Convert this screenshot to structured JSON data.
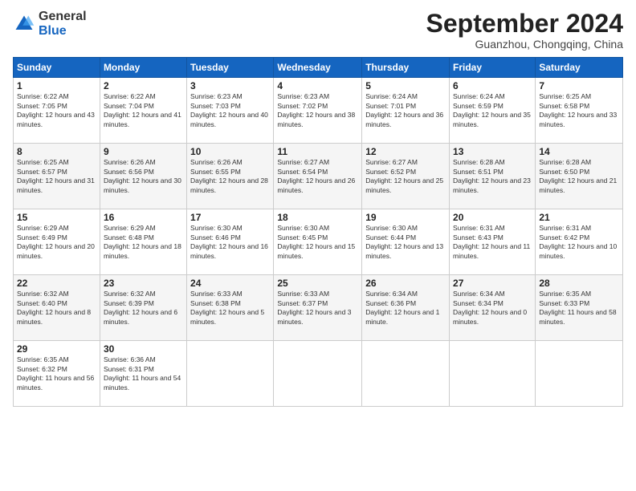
{
  "header": {
    "logo_general": "General",
    "logo_blue": "Blue",
    "month_title": "September 2024",
    "subtitle": "Guanzhou, Chongqing, China"
  },
  "weekdays": [
    "Sunday",
    "Monday",
    "Tuesday",
    "Wednesday",
    "Thursday",
    "Friday",
    "Saturday"
  ],
  "weeks": [
    [
      {
        "day": "1",
        "sunrise": "6:22 AM",
        "sunset": "7:05 PM",
        "daylight": "12 hours and 43 minutes."
      },
      {
        "day": "2",
        "sunrise": "6:22 AM",
        "sunset": "7:04 PM",
        "daylight": "12 hours and 41 minutes."
      },
      {
        "day": "3",
        "sunrise": "6:23 AM",
        "sunset": "7:03 PM",
        "daylight": "12 hours and 40 minutes."
      },
      {
        "day": "4",
        "sunrise": "6:23 AM",
        "sunset": "7:02 PM",
        "daylight": "12 hours and 38 minutes."
      },
      {
        "day": "5",
        "sunrise": "6:24 AM",
        "sunset": "7:01 PM",
        "daylight": "12 hours and 36 minutes."
      },
      {
        "day": "6",
        "sunrise": "6:24 AM",
        "sunset": "6:59 PM",
        "daylight": "12 hours and 35 minutes."
      },
      {
        "day": "7",
        "sunrise": "6:25 AM",
        "sunset": "6:58 PM",
        "daylight": "12 hours and 33 minutes."
      }
    ],
    [
      {
        "day": "8",
        "sunrise": "6:25 AM",
        "sunset": "6:57 PM",
        "daylight": "12 hours and 31 minutes."
      },
      {
        "day": "9",
        "sunrise": "6:26 AM",
        "sunset": "6:56 PM",
        "daylight": "12 hours and 30 minutes."
      },
      {
        "day": "10",
        "sunrise": "6:26 AM",
        "sunset": "6:55 PM",
        "daylight": "12 hours and 28 minutes."
      },
      {
        "day": "11",
        "sunrise": "6:27 AM",
        "sunset": "6:54 PM",
        "daylight": "12 hours and 26 minutes."
      },
      {
        "day": "12",
        "sunrise": "6:27 AM",
        "sunset": "6:52 PM",
        "daylight": "12 hours and 25 minutes."
      },
      {
        "day": "13",
        "sunrise": "6:28 AM",
        "sunset": "6:51 PM",
        "daylight": "12 hours and 23 minutes."
      },
      {
        "day": "14",
        "sunrise": "6:28 AM",
        "sunset": "6:50 PM",
        "daylight": "12 hours and 21 minutes."
      }
    ],
    [
      {
        "day": "15",
        "sunrise": "6:29 AM",
        "sunset": "6:49 PM",
        "daylight": "12 hours and 20 minutes."
      },
      {
        "day": "16",
        "sunrise": "6:29 AM",
        "sunset": "6:48 PM",
        "daylight": "12 hours and 18 minutes."
      },
      {
        "day": "17",
        "sunrise": "6:30 AM",
        "sunset": "6:46 PM",
        "daylight": "12 hours and 16 minutes."
      },
      {
        "day": "18",
        "sunrise": "6:30 AM",
        "sunset": "6:45 PM",
        "daylight": "12 hours and 15 minutes."
      },
      {
        "day": "19",
        "sunrise": "6:30 AM",
        "sunset": "6:44 PM",
        "daylight": "12 hours and 13 minutes."
      },
      {
        "day": "20",
        "sunrise": "6:31 AM",
        "sunset": "6:43 PM",
        "daylight": "12 hours and 11 minutes."
      },
      {
        "day": "21",
        "sunrise": "6:31 AM",
        "sunset": "6:42 PM",
        "daylight": "12 hours and 10 minutes."
      }
    ],
    [
      {
        "day": "22",
        "sunrise": "6:32 AM",
        "sunset": "6:40 PM",
        "daylight": "12 hours and 8 minutes."
      },
      {
        "day": "23",
        "sunrise": "6:32 AM",
        "sunset": "6:39 PM",
        "daylight": "12 hours and 6 minutes."
      },
      {
        "day": "24",
        "sunrise": "6:33 AM",
        "sunset": "6:38 PM",
        "daylight": "12 hours and 5 minutes."
      },
      {
        "day": "25",
        "sunrise": "6:33 AM",
        "sunset": "6:37 PM",
        "daylight": "12 hours and 3 minutes."
      },
      {
        "day": "26",
        "sunrise": "6:34 AM",
        "sunset": "6:36 PM",
        "daylight": "12 hours and 1 minute."
      },
      {
        "day": "27",
        "sunrise": "6:34 AM",
        "sunset": "6:34 PM",
        "daylight": "12 hours and 0 minutes."
      },
      {
        "day": "28",
        "sunrise": "6:35 AM",
        "sunset": "6:33 PM",
        "daylight": "11 hours and 58 minutes."
      }
    ],
    [
      {
        "day": "29",
        "sunrise": "6:35 AM",
        "sunset": "6:32 PM",
        "daylight": "11 hours and 56 minutes."
      },
      {
        "day": "30",
        "sunrise": "6:36 AM",
        "sunset": "6:31 PM",
        "daylight": "11 hours and 54 minutes."
      },
      null,
      null,
      null,
      null,
      null
    ]
  ],
  "labels": {
    "sunrise": "Sunrise: ",
    "sunset": "Sunset: ",
    "daylight": "Daylight: "
  }
}
